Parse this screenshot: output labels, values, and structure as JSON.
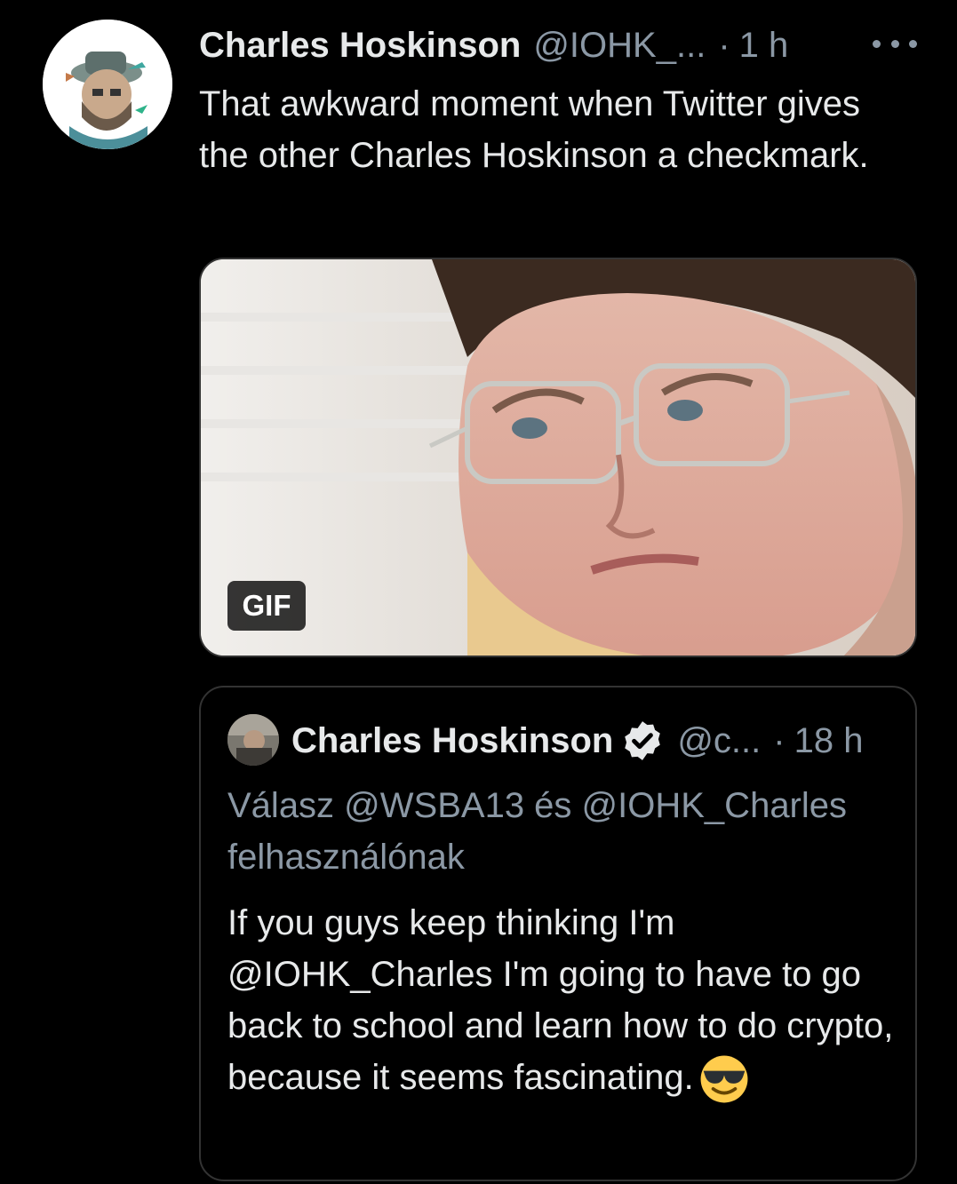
{
  "tweet": {
    "author_name": "Charles Hoskinson",
    "author_handle": "@IOHK_...",
    "separator": "·",
    "time": "1 h",
    "more_icon": "more-horizontal-icon",
    "text": "That awkward moment when Twitter gives the other Charles Hoskinson a checkmark.",
    "media": {
      "badge": "GIF"
    }
  },
  "quote": {
    "author_name": "Charles Hoskinson",
    "verified_icon": "verified-badge-icon",
    "author_handle": "@c...",
    "separator": "·",
    "time": "18 h",
    "reply_to": "Válasz @WSBA13 és @IOHK_Charles felhasználónak",
    "text": "If you guys keep thinking I'm @IOHK_Charles I'm going to have to go back to school and learn how to do crypto, because it seems fascinating.",
    "emoji": "smiling-face-with-sunglasses-icon"
  },
  "colors": {
    "background": "#000000",
    "text_primary": "#e7e9ea",
    "text_secondary": "#8b98a5",
    "border": "#333333"
  }
}
